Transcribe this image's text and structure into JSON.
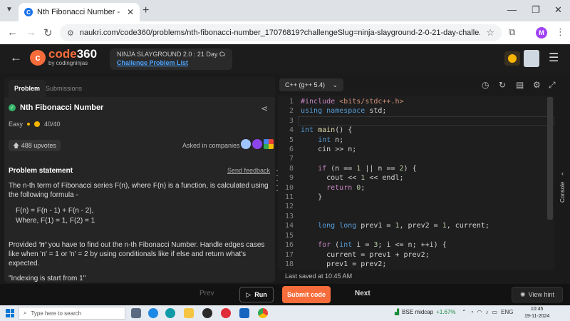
{
  "browser": {
    "tab_title": "Nth Fibonacci Number - Naukri",
    "url": "naukri.com/code360/problems/nth-fibonacci-number_17076819?challengeSlug=ninja-slayground-2-0-21-day-challe...",
    "profile_initial": "M"
  },
  "header": {
    "logo_main_a": "code",
    "logo_main_b": "360",
    "logo_sub": "by codingninjas",
    "challenge_title": "NINJA SLAYGROUND 2.0 : 21 Day Co...",
    "challenge_link": "Challenge Problem List"
  },
  "left_tabs": [
    "Problem",
    "Submissions"
  ],
  "problem": {
    "title": "Nth Fibonacci Number",
    "difficulty": "Easy",
    "points": "40/40",
    "upvotes": "488 upvotes",
    "asked_label": "Asked in companies",
    "statement_heading": "Problem statement",
    "feedback": "Send feedback",
    "para1": "The n-th term of Fibonacci series F(n), where F(n) is a function, is calculated using the following formula -",
    "formula1": "F(n) = F(n - 1) + F(n - 2),",
    "formula2": "Where, F(1) = 1, F(2) = 1",
    "para2_a": "Provided ",
    "para2_n": "'n'",
    "para2_b": " you have to find out the n-th Fibonacci Number. Handle edges cases like when 'n' = 1 or 'n' = 2 by using conditionals like if else and return what's expected.",
    "para3": "\"Indexing is start from 1\""
  },
  "editor": {
    "language": "C++ (g++ 5.4)",
    "saved": "Last saved at 10:45 AM",
    "console_label": "Console",
    "line_numbers": [
      "1",
      "2",
      "3",
      "4",
      "5",
      "6",
      "7",
      "8",
      "9",
      "10",
      "11",
      "12",
      "13",
      "14",
      "15",
      "16",
      "17",
      "18"
    ]
  },
  "bottom": {
    "prev": "Prev",
    "run": "Run",
    "submit": "Submit code",
    "next": "Next",
    "hint": "View hint"
  },
  "taskbar": {
    "search_placeholder": "Type here to search",
    "stock_name": "BSE midcap",
    "stock_change": "+1.67%",
    "lang": "ENG",
    "time": "10:45",
    "date": "19-11-2024"
  }
}
